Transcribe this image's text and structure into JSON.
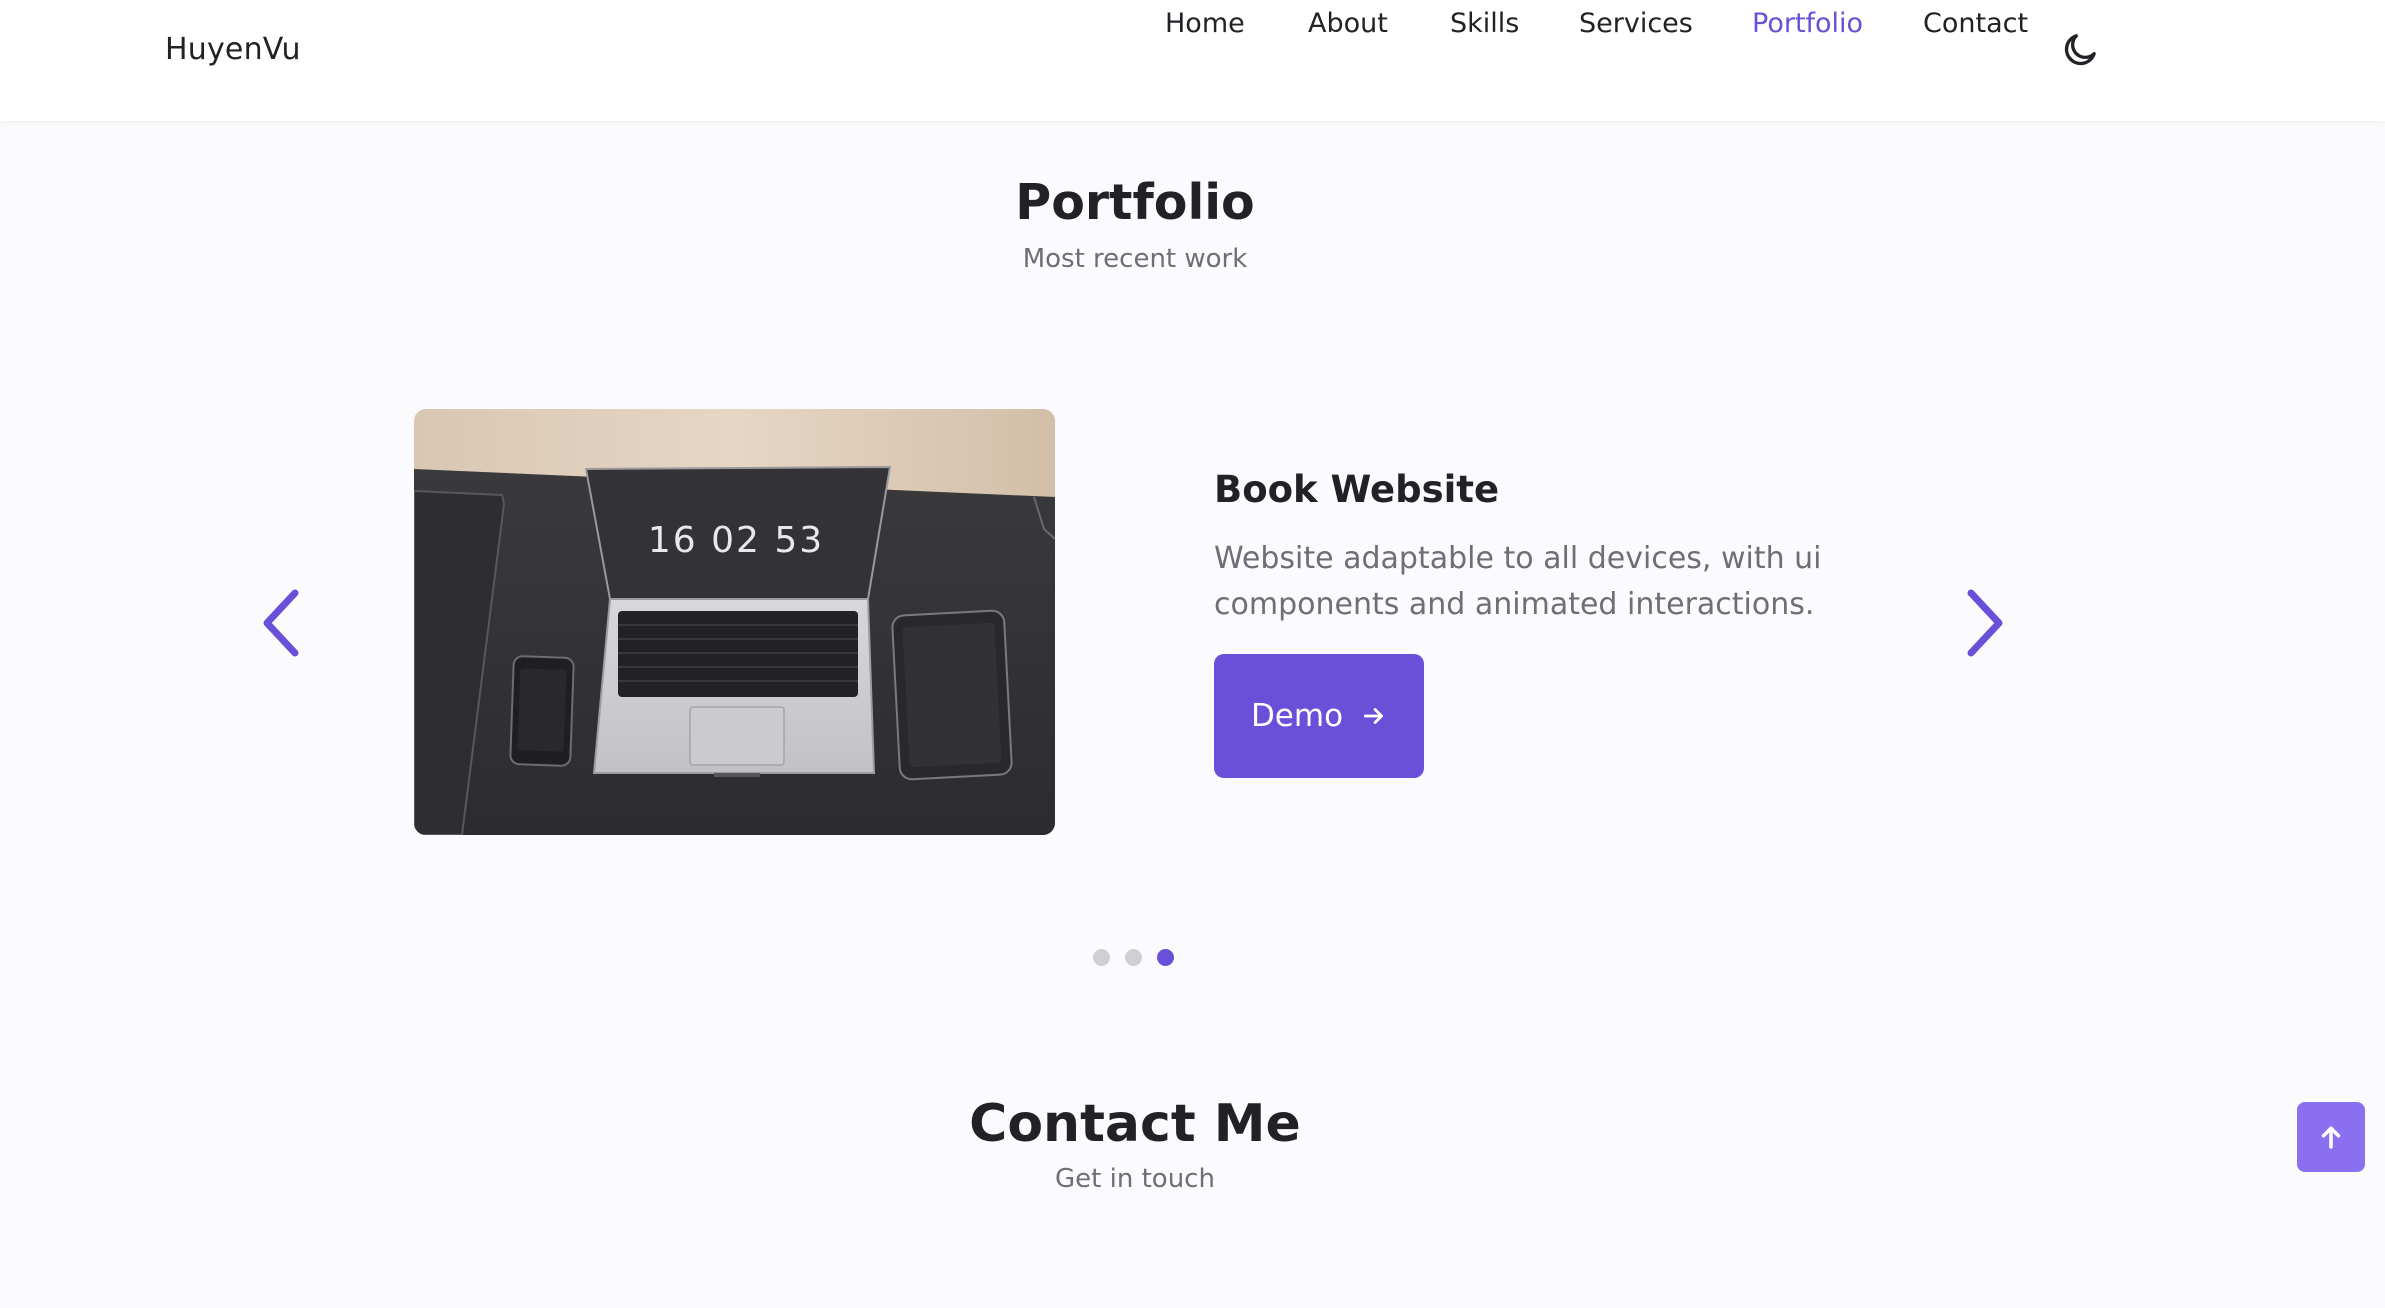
{
  "header": {
    "logo": "HuyenVu",
    "nav": [
      {
        "label": "Home",
        "active": false
      },
      {
        "label": "About",
        "active": false
      },
      {
        "label": "Skills",
        "active": false
      },
      {
        "label": "Services",
        "active": false
      },
      {
        "label": "Portfolio",
        "active": true
      },
      {
        "label": "Contact",
        "active": false
      }
    ],
    "theme_icon": "moon-icon"
  },
  "portfolio": {
    "title": "Portfolio",
    "subtitle": "Most recent work",
    "project": {
      "title": "Book Website",
      "description": "Website adaptable to all devices, with ui components and animated interactions.",
      "button_label": "Demo",
      "button_icon": "arrow-right-icon",
      "image_clock_text": "16 02 53"
    },
    "prev_icon": "chevron-left-icon",
    "next_icon": "chevron-right-icon",
    "slides": {
      "total": 3,
      "active_index": 2
    }
  },
  "contact": {
    "title": "Contact Me",
    "subtitle": "Get in touch"
  },
  "scroll_up_icon": "arrow-up-icon",
  "colors": {
    "accent": "#6a4fd8",
    "scroll_button": "#8a6ff0",
    "text": "#222226",
    "muted_text": "#6e6e78",
    "background": "#fbfbfd"
  }
}
